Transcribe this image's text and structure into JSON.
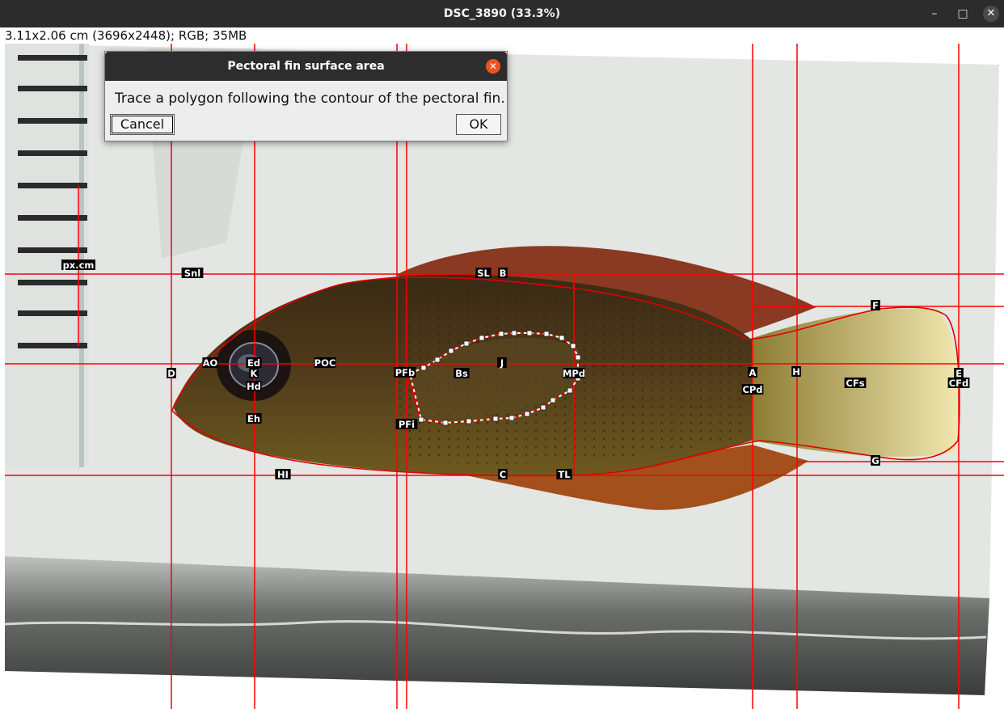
{
  "window": {
    "title": "DSC_3890 (33.3%)",
    "controls": {
      "minimize": "–",
      "maximize": "□",
      "close": "✕"
    }
  },
  "image_info": "3.11x2.06 cm (3696x2448); RGB; 35MB",
  "dialog": {
    "title": "Pectoral fin surface area",
    "close_glyph": "✕",
    "message": "Trace a polygon following the contour of the pectoral fin.",
    "cancel_label": "Cancel",
    "ok_label": "OK"
  },
  "landmarks": [
    "px.cm",
    "Snl",
    "SL",
    "B",
    "AO",
    "Ed",
    "K",
    "Hd",
    "Eh",
    "D",
    "POC",
    "PFb",
    "Bs",
    "J",
    "MPd",
    "PFi",
    "A",
    "CPd",
    "H",
    "F",
    "CFs",
    "E",
    "CFd",
    "G",
    "HI",
    "C",
    "TL"
  ],
  "colors": {
    "guide_line": "#ff0000",
    "outline": "#e00000",
    "handle": "#ffffff",
    "titlebar": "#2c2c2c",
    "dialog_close": "#e95420"
  }
}
